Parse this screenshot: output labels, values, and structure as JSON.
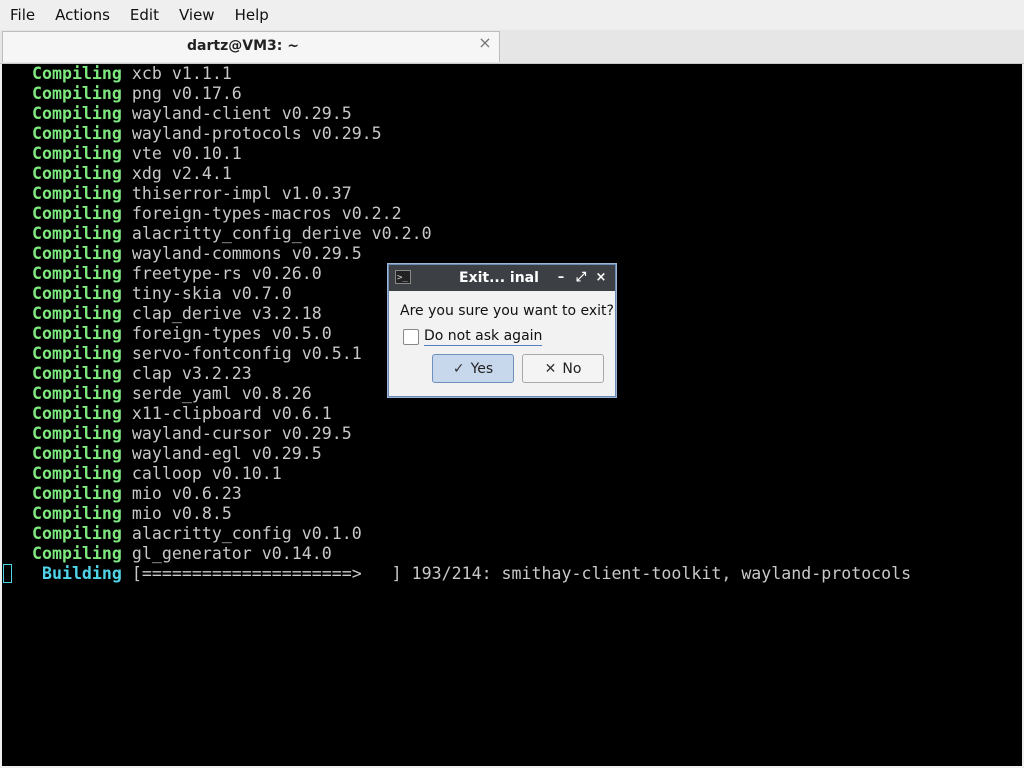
{
  "menu": [
    "File",
    "Actions",
    "Edit",
    "View",
    "Help"
  ],
  "tab": {
    "title": "dartz@VM3: ~",
    "close_glyph": "×"
  },
  "terminal": {
    "compile_lines": [
      {
        "verb": "Compiling",
        "text": "xcb v1.1.1"
      },
      {
        "verb": "Compiling",
        "text": "png v0.17.6"
      },
      {
        "verb": "Compiling",
        "text": "wayland-client v0.29.5"
      },
      {
        "verb": "Compiling",
        "text": "wayland-protocols v0.29.5"
      },
      {
        "verb": "Compiling",
        "text": "vte v0.10.1"
      },
      {
        "verb": "Compiling",
        "text": "xdg v2.4.1"
      },
      {
        "verb": "Compiling",
        "text": "thiserror-impl v1.0.37"
      },
      {
        "verb": "Compiling",
        "text": "foreign-types-macros v0.2.2"
      },
      {
        "verb": "Compiling",
        "text": "alacritty_config_derive v0.2.0"
      },
      {
        "verb": "Compiling",
        "text": "wayland-commons v0.29.5"
      },
      {
        "verb": "Compiling",
        "text": "freetype-rs v0.26.0"
      },
      {
        "verb": "Compiling",
        "text": "tiny-skia v0.7.0"
      },
      {
        "verb": "Compiling",
        "text": "clap_derive v3.2.18"
      },
      {
        "verb": "Compiling",
        "text": "foreign-types v0.5.0"
      },
      {
        "verb": "Compiling",
        "text": "servo-fontconfig v0.5.1"
      },
      {
        "verb": "Compiling",
        "text": "clap v3.2.23"
      },
      {
        "verb": "Compiling",
        "text": "serde_yaml v0.8.26"
      },
      {
        "verb": "Compiling",
        "text": "x11-clipboard v0.6.1"
      },
      {
        "verb": "Compiling",
        "text": "wayland-cursor v0.29.5"
      },
      {
        "verb": "Compiling",
        "text": "wayland-egl v0.29.5"
      },
      {
        "verb": "Compiling",
        "text": "calloop v0.10.1"
      },
      {
        "verb": "Compiling",
        "text": "mio v0.6.23"
      },
      {
        "verb": "Compiling",
        "text": "mio v0.8.5"
      },
      {
        "verb": "Compiling",
        "text": "alacritty_config v0.1.0"
      },
      {
        "verb": "Compiling",
        "text": "gl_generator v0.14.0"
      }
    ],
    "building_line": {
      "verb": "Building",
      "text": "[=====================>   ] 193/214: smithay-client-toolkit, wayland-protocols"
    },
    "colors": {
      "background": "#000000",
      "compiling": "#7ee87e",
      "building": "#4fd4e8",
      "text": "#c8c8c8"
    }
  },
  "dialog": {
    "title": "Exit... inal",
    "app_icon_glyph": ">_",
    "minimize_glyph": "–",
    "maximize_glyph": "⤢",
    "close_glyph": "×",
    "question": "Are you sure you want to exit?",
    "checkbox_label": "Do not ask again",
    "checkbox_checked": false,
    "yes_glyph": "✓",
    "yes_label": "Yes",
    "no_glyph": "✕",
    "no_label": "No"
  }
}
